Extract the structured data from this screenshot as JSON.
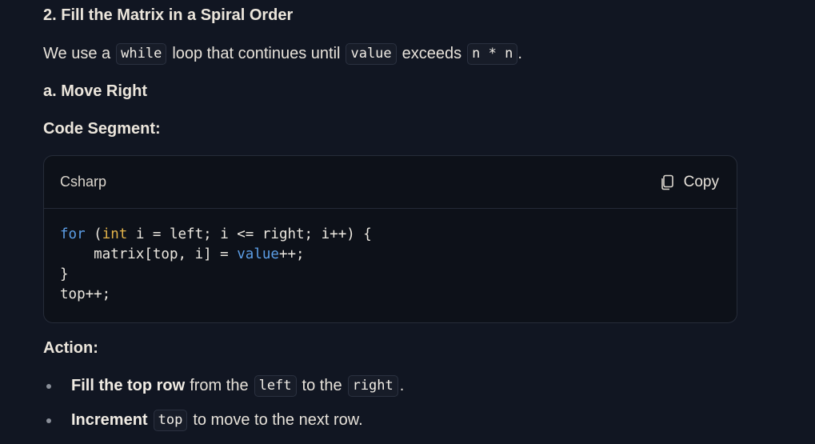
{
  "section": {
    "heading": "2. Fill the Matrix in a Spiral Order",
    "intro": {
      "t1": "We use a",
      "c1": "while",
      "t2": "loop that continues until",
      "c2": "value",
      "t3": "exceeds",
      "c3": "n * n",
      "t4": "."
    },
    "subheading": "a. Move Right",
    "code_segment_label": "Code Segment:"
  },
  "code_block": {
    "language": "Csharp",
    "copy_label": "Copy",
    "copy_icon": "copy-icon",
    "lines": {
      "l1_kw": "for",
      "l1_p1": " (",
      "l1_ty": "int",
      "l1_rest": " i = left; i <= right; i++) {",
      "l2_pre": "    matrix[top, i] = ",
      "l2_kw": "value",
      "l2_post": "++;",
      "l3": "}",
      "l4": "top++;"
    },
    "colors": {
      "keyword": "#5c9ee6",
      "type": "#e3b34a"
    }
  },
  "action": {
    "heading": "Action:",
    "items": [
      {
        "bold": "Fill the top row",
        "t1": "from the",
        "c1": "left",
        "t2": "to the",
        "c2": "right",
        "t3": "."
      },
      {
        "bold": "Increment",
        "c1": "top",
        "t1": "to move to the next row."
      }
    ]
  }
}
